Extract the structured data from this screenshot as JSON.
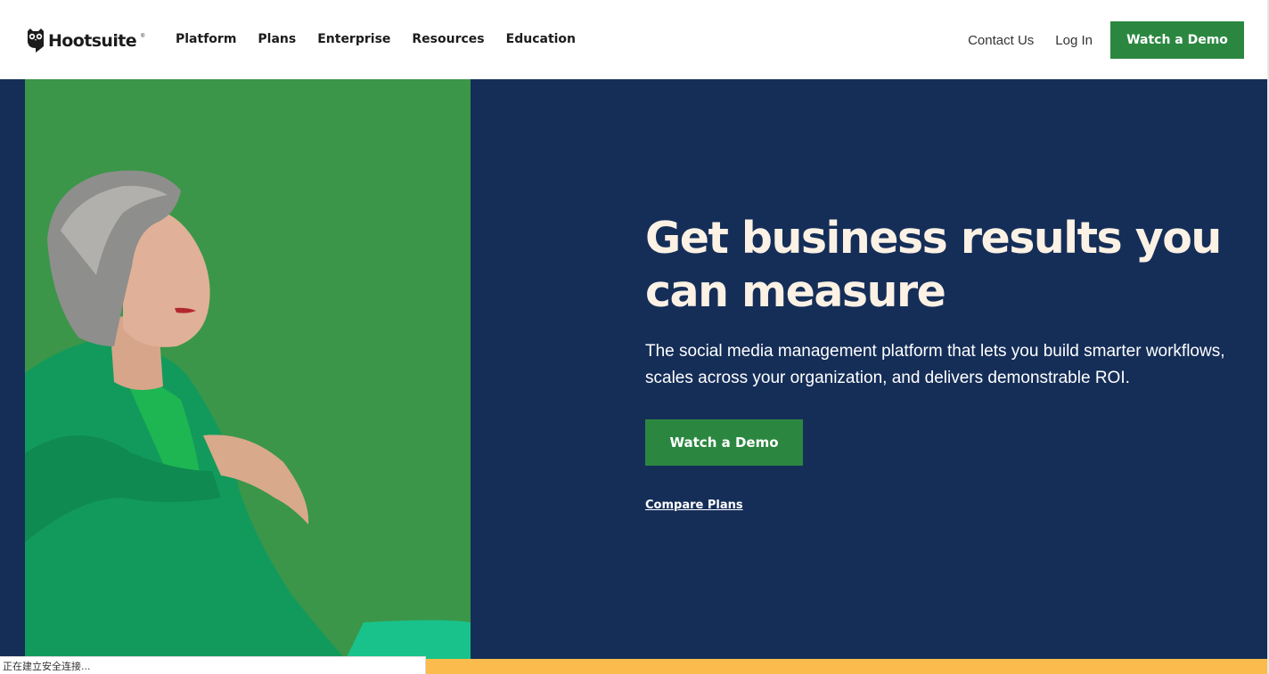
{
  "header": {
    "logo_text": "Hootsuite",
    "logo_reg": "®",
    "nav": [
      "Platform",
      "Plans",
      "Enterprise",
      "Resources",
      "Education"
    ],
    "contact": "Contact Us",
    "login": "Log In",
    "cta": "Watch a Demo"
  },
  "hero": {
    "title": "Get business results you can measure",
    "subtitle": "The social media management platform that lets you build smarter workflows, scales across your organization, and delivers demonstrable ROI.",
    "cta": "Watch a Demo",
    "link": "Compare Plans"
  },
  "status_bar": "正在建立安全连接...",
  "colors": {
    "brand_green": "#2b8740",
    "hero_navy": "#152e58",
    "title_cream": "#fbf1e4",
    "accent_yellow": "#fbbc4d"
  }
}
